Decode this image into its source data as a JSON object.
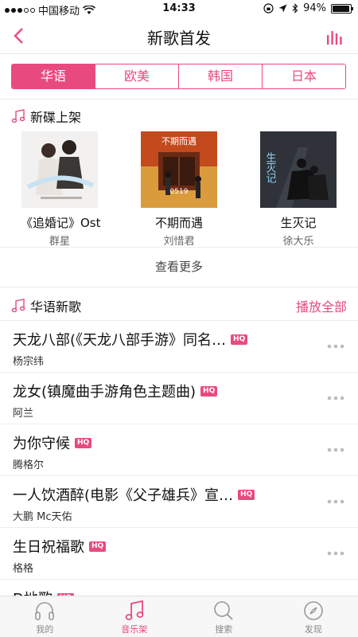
{
  "status": {
    "carrier": "中国移动",
    "time": "14:33",
    "battery": "94%",
    "battery_level": 0.94
  },
  "nav": {
    "title": "新歌首发"
  },
  "tabs": [
    "华语",
    "欧美",
    "韩国",
    "日本"
  ],
  "active_tab": 0,
  "albums_section": {
    "title": "新碟上架",
    "albums": [
      {
        "title": "《追婚记》Ost",
        "artist": "群星"
      },
      {
        "title": "不期而遇",
        "artist": "刘惜君"
      },
      {
        "title": "生灭记",
        "artist": "徐大乐"
      }
    ],
    "more": "查看更多"
  },
  "cover_text": {
    "album2_title": "不期而遇",
    "album2_code": "0519",
    "album3_title": "生灭记"
  },
  "songs_section": {
    "title": "华语新歌",
    "play_all": "播放全部",
    "hq_label": "HQ",
    "songs": [
      {
        "title": "天龙八部(《天龙八部手游》同名…",
        "artist": "杨宗纬"
      },
      {
        "title": "龙女(镇魔曲手游角色主题曲)",
        "artist": "阿兰"
      },
      {
        "title": "为你守候",
        "artist": "腾格尔"
      },
      {
        "title": "一人饮酒醉(电影《父子雄兵》宣…",
        "artist": "大鹏 Mc天佑"
      },
      {
        "title": "生日祝福歌",
        "artist": "格格"
      },
      {
        "title": "D地歌",
        "artist": ""
      }
    ]
  },
  "tabbar": {
    "items": [
      "我的",
      "音乐架",
      "搜索",
      "发现"
    ],
    "active": 1
  },
  "colors": {
    "accent": "#e84a7f"
  }
}
